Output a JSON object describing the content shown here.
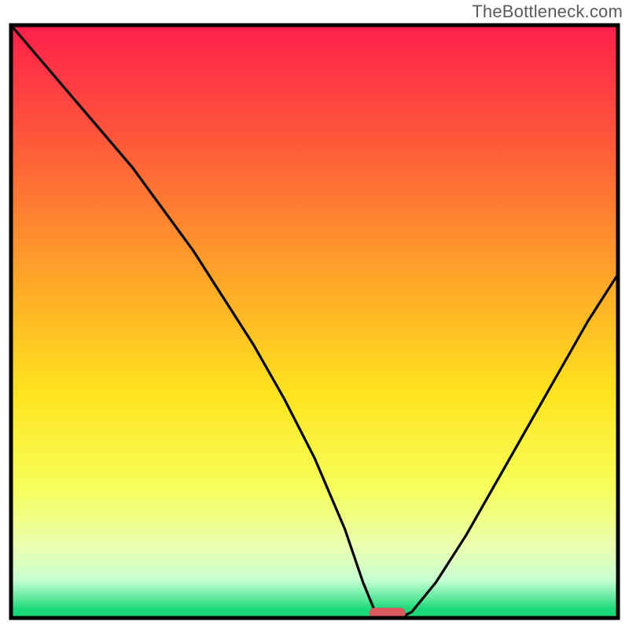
{
  "watermark": "TheBottleneck.com",
  "chart_data": {
    "type": "line",
    "title": "",
    "xlabel": "",
    "ylabel": "",
    "x_range": [
      0,
      100
    ],
    "y_range": [
      0,
      100
    ],
    "optimum_marker": {
      "x": 62,
      "width": 6,
      "color": "#d9595f"
    },
    "gradient_stops": [
      {
        "offset": 0.0,
        "color": "#ff1f4b"
      },
      {
        "offset": 0.2,
        "color": "#ff5a3a"
      },
      {
        "offset": 0.42,
        "color": "#ffa329"
      },
      {
        "offset": 0.62,
        "color": "#ffe31e"
      },
      {
        "offset": 0.78,
        "color": "#f6ff5a"
      },
      {
        "offset": 0.88,
        "color": "#eaffb0"
      },
      {
        "offset": 0.935,
        "color": "#c8ffd2"
      },
      {
        "offset": 0.965,
        "color": "#66e9a0"
      },
      {
        "offset": 0.985,
        "color": "#1bd97a"
      },
      {
        "offset": 1.0,
        "color": "#17d977"
      }
    ],
    "series": [
      {
        "name": "bottleneck-curve",
        "color": "#000000",
        "x": [
          0,
          5,
          10,
          15,
          20,
          25,
          30,
          35,
          40,
          45,
          50,
          55,
          58,
          60,
          62,
          64,
          66,
          70,
          75,
          80,
          85,
          90,
          95,
          100
        ],
        "y": [
          100,
          94,
          88,
          82,
          76,
          69,
          62,
          54,
          46,
          37,
          27,
          15,
          6,
          1,
          0,
          0,
          1,
          6,
          14,
          23,
          32,
          41,
          50,
          58
        ]
      }
    ]
  }
}
